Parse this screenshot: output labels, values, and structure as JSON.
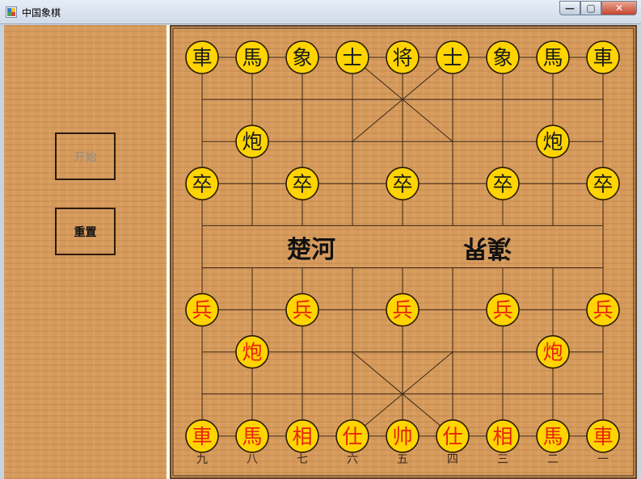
{
  "window": {
    "title": "中国象棋",
    "minimize_label": "—",
    "maximize_label": "▢",
    "close_label": "✕"
  },
  "sidebar": {
    "start_button": "开始",
    "reset_button": "重置"
  },
  "board": {
    "river_left": "楚河",
    "river_right": "漢界",
    "bottom_file_numbers": [
      "九",
      "八",
      "七",
      "六",
      "五",
      "四",
      "三",
      "二",
      "一"
    ],
    "colors": {
      "line": "#3b2716",
      "piece_fill": "#ffd400",
      "piece_border": "#2a1a00",
      "black_text": "#1a1a1a",
      "red_text": "#e8230e"
    },
    "pieces": [
      {
        "label": "車",
        "side": "black",
        "file": 0,
        "rank": 0
      },
      {
        "label": "馬",
        "side": "black",
        "file": 1,
        "rank": 0
      },
      {
        "label": "象",
        "side": "black",
        "file": 2,
        "rank": 0
      },
      {
        "label": "士",
        "side": "black",
        "file": 3,
        "rank": 0
      },
      {
        "label": "将",
        "side": "black",
        "file": 4,
        "rank": 0
      },
      {
        "label": "士",
        "side": "black",
        "file": 5,
        "rank": 0
      },
      {
        "label": "象",
        "side": "black",
        "file": 6,
        "rank": 0
      },
      {
        "label": "馬",
        "side": "black",
        "file": 7,
        "rank": 0
      },
      {
        "label": "車",
        "side": "black",
        "file": 8,
        "rank": 0
      },
      {
        "label": "炮",
        "side": "black",
        "file": 1,
        "rank": 2
      },
      {
        "label": "炮",
        "side": "black",
        "file": 7,
        "rank": 2
      },
      {
        "label": "卒",
        "side": "black",
        "file": 0,
        "rank": 3
      },
      {
        "label": "卒",
        "side": "black",
        "file": 2,
        "rank": 3
      },
      {
        "label": "卒",
        "side": "black",
        "file": 4,
        "rank": 3
      },
      {
        "label": "卒",
        "side": "black",
        "file": 6,
        "rank": 3
      },
      {
        "label": "卒",
        "side": "black",
        "file": 8,
        "rank": 3
      },
      {
        "label": "兵",
        "side": "red",
        "file": 0,
        "rank": 6
      },
      {
        "label": "兵",
        "side": "red",
        "file": 2,
        "rank": 6
      },
      {
        "label": "兵",
        "side": "red",
        "file": 4,
        "rank": 6
      },
      {
        "label": "兵",
        "side": "red",
        "file": 6,
        "rank": 6
      },
      {
        "label": "兵",
        "side": "red",
        "file": 8,
        "rank": 6
      },
      {
        "label": "炮",
        "side": "red",
        "file": 1,
        "rank": 7
      },
      {
        "label": "炮",
        "side": "red",
        "file": 7,
        "rank": 7
      },
      {
        "label": "車",
        "side": "red",
        "file": 0,
        "rank": 9
      },
      {
        "label": "馬",
        "side": "red",
        "file": 1,
        "rank": 9
      },
      {
        "label": "相",
        "side": "red",
        "file": 2,
        "rank": 9
      },
      {
        "label": "仕",
        "side": "red",
        "file": 3,
        "rank": 9
      },
      {
        "label": "帅",
        "side": "red",
        "file": 4,
        "rank": 9
      },
      {
        "label": "仕",
        "side": "red",
        "file": 5,
        "rank": 9
      },
      {
        "label": "相",
        "side": "red",
        "file": 6,
        "rank": 9
      },
      {
        "label": "馬",
        "side": "red",
        "file": 7,
        "rank": 9
      },
      {
        "label": "車",
        "side": "red",
        "file": 8,
        "rank": 9
      }
    ]
  }
}
